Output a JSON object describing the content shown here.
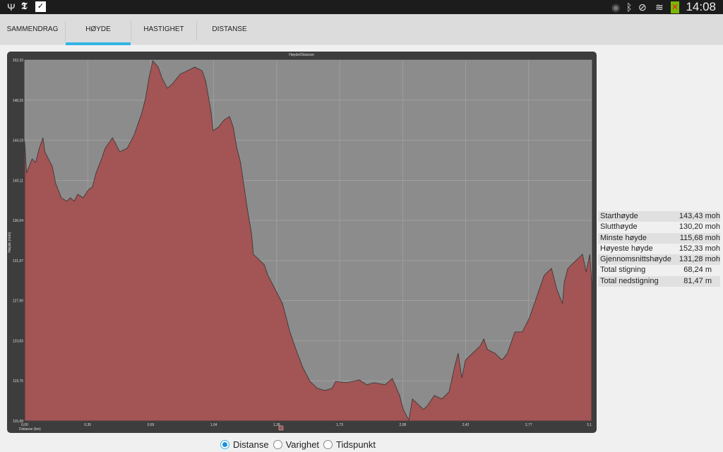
{
  "status_bar": {
    "left_icons": [
      "usb-icon",
      "nyt-app-icon",
      "task-check-icon"
    ],
    "right_icons": [
      "eye-icon",
      "bluetooth-icon",
      "muted-vibrate-icon",
      "wifi-icon",
      "battery-charging-icon"
    ],
    "time": "14:08"
  },
  "tabs": [
    {
      "label": "SAMMENDRAG",
      "active": false
    },
    {
      "label": "HØYDE",
      "active": true
    },
    {
      "label": "HASTIGHET",
      "active": false
    },
    {
      "label": "DISTANSE",
      "active": false
    }
  ],
  "colors": {
    "accent": "#33b5e5",
    "area_fill": "#a35454",
    "plot_bg": "#8c8c8c",
    "panel_bg": "#3d3d3d"
  },
  "chart_data": {
    "type": "area",
    "title": "Høyde/Distanse",
    "xlabel": "Distanse (km)",
    "ylabel": "Høyde (moh)",
    "xlim": [
      0,
      3.1
    ],
    "ylim": [
      115.68,
      152.33
    ],
    "grid": true,
    "legend": "bottom-center",
    "x_ticks": [
      "0,00",
      "0,35",
      "0,69",
      "1,04",
      "1,38",
      "1,73",
      "2,08",
      "2,42",
      "2,77",
      "3,1"
    ],
    "y_ticks": [
      "115,68",
      "119,75",
      "123,83",
      "127,90",
      "131,97",
      "136,04",
      "140,11",
      "144,18",
      "148,25",
      "152,33"
    ],
    "series": [
      {
        "name": "Høyde",
        "points": [
          [
            0.0,
            144.08
          ],
          [
            0.01,
            140.86
          ],
          [
            0.04,
            142.29
          ],
          [
            0.06,
            141.93
          ],
          [
            0.08,
            143.37
          ],
          [
            0.1,
            144.44
          ],
          [
            0.11,
            143.01
          ],
          [
            0.14,
            141.93
          ],
          [
            0.15,
            141.57
          ],
          [
            0.17,
            139.78
          ],
          [
            0.2,
            138.35
          ],
          [
            0.23,
            137.99
          ],
          [
            0.25,
            138.35
          ],
          [
            0.27,
            137.99
          ],
          [
            0.29,
            138.71
          ],
          [
            0.32,
            138.35
          ],
          [
            0.35,
            139.21
          ],
          [
            0.37,
            139.42
          ],
          [
            0.39,
            140.86
          ],
          [
            0.42,
            142.29
          ],
          [
            0.44,
            143.37
          ],
          [
            0.48,
            144.44
          ],
          [
            0.52,
            143.01
          ],
          [
            0.56,
            143.37
          ],
          [
            0.6,
            144.8
          ],
          [
            0.64,
            146.95
          ],
          [
            0.66,
            148.39
          ],
          [
            0.68,
            150.54
          ],
          [
            0.7,
            152.26
          ],
          [
            0.73,
            151.61
          ],
          [
            0.75,
            150.54
          ],
          [
            0.78,
            149.46
          ],
          [
            0.81,
            149.96
          ],
          [
            0.85,
            150.9
          ],
          [
            0.89,
            151.25
          ],
          [
            0.93,
            151.61
          ],
          [
            0.97,
            151.25
          ],
          [
            0.99,
            150.18
          ],
          [
            1.02,
            146.95
          ],
          [
            1.03,
            145.16
          ],
          [
            1.06,
            145.52
          ],
          [
            1.09,
            146.24
          ],
          [
            1.12,
            146.6
          ],
          [
            1.14,
            145.52
          ],
          [
            1.16,
            143.37
          ],
          [
            1.18,
            141.93
          ],
          [
            1.2,
            139.42
          ],
          [
            1.22,
            136.91
          ],
          [
            1.24,
            134.76
          ],
          [
            1.25,
            132.61
          ],
          [
            1.29,
            131.9
          ],
          [
            1.31,
            131.54
          ],
          [
            1.33,
            130.46
          ],
          [
            1.37,
            129.03
          ],
          [
            1.41,
            127.59
          ],
          [
            1.45,
            124.72
          ],
          [
            1.49,
            122.57
          ],
          [
            1.52,
            121.14
          ],
          [
            1.56,
            119.7
          ],
          [
            1.6,
            118.99
          ],
          [
            1.64,
            118.77
          ],
          [
            1.68,
            118.99
          ],
          [
            1.7,
            119.7
          ],
          [
            1.76,
            119.56
          ],
          [
            1.83,
            119.85
          ],
          [
            1.87,
            119.35
          ],
          [
            1.91,
            119.56
          ],
          [
            1.97,
            119.35
          ],
          [
            2.01,
            119.99
          ],
          [
            2.03,
            119.13
          ],
          [
            2.05,
            118.27
          ],
          [
            2.07,
            116.84
          ],
          [
            2.1,
            115.76
          ],
          [
            2.12,
            117.91
          ],
          [
            2.14,
            117.56
          ],
          [
            2.18,
            116.84
          ],
          [
            2.2,
            117.2
          ],
          [
            2.24,
            118.27
          ],
          [
            2.28,
            117.91
          ],
          [
            2.32,
            118.63
          ],
          [
            2.35,
            121.14
          ],
          [
            2.37,
            122.57
          ],
          [
            2.39,
            120.06
          ],
          [
            2.41,
            121.86
          ],
          [
            2.45,
            122.57
          ],
          [
            2.49,
            123.29
          ],
          [
            2.51,
            124.01
          ],
          [
            2.53,
            122.93
          ],
          [
            2.57,
            122.57
          ],
          [
            2.61,
            121.86
          ],
          [
            2.64,
            122.57
          ],
          [
            2.68,
            124.72
          ],
          [
            2.72,
            124.72
          ],
          [
            2.76,
            126.16
          ],
          [
            2.8,
            128.31
          ],
          [
            2.84,
            130.46
          ],
          [
            2.88,
            131.18
          ],
          [
            2.91,
            129.03
          ],
          [
            2.94,
            127.59
          ],
          [
            2.95,
            129.74
          ],
          [
            2.97,
            131.18
          ],
          [
            3.01,
            131.9
          ],
          [
            3.05,
            132.61
          ],
          [
            3.07,
            130.82
          ],
          [
            3.09,
            132.61
          ],
          [
            3.1,
            129.74
          ]
        ]
      }
    ]
  },
  "stats": [
    {
      "label": "Starthøyde",
      "value": "143,43 moh"
    },
    {
      "label": "Slutthøyde",
      "value": "130,20 moh"
    },
    {
      "label": "Minste høyde",
      "value": "115,68 moh"
    },
    {
      "label": "Høyeste høyde",
      "value": "152,33 moh"
    },
    {
      "label": "Gjennomsnittshøyde",
      "value": "131,28 moh"
    },
    {
      "label": "Total stigning",
      "value": "68,24 m"
    },
    {
      "label": "Total nedstigning",
      "value": "81,47 m"
    }
  ],
  "x_axis_options": [
    {
      "label": "Distanse",
      "selected": true
    },
    {
      "label": "Varighet",
      "selected": false
    },
    {
      "label": "Tidspunkt",
      "selected": false
    }
  ]
}
